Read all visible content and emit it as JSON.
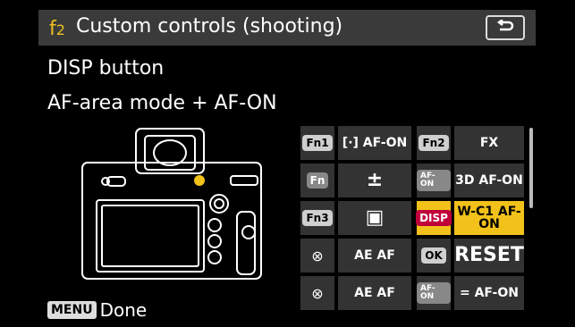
{
  "header": {
    "menu_letter": "f",
    "menu_number": "2",
    "title": "Custom controls (shooting)"
  },
  "info": {
    "button_name": "DISP button",
    "assignment": "AF-area mode + AF-ON"
  },
  "footer": {
    "menu_tag": "MENU",
    "done_label": "Done"
  },
  "grid": {
    "rows": [
      {
        "left_btn": "Fn1",
        "left_func": "[·] AF-ON",
        "right_btn": "Fn2",
        "right_func": "FX"
      },
      {
        "left_btn": "Fn",
        "left_func": "±",
        "right_btn": "AF-ON",
        "right_func": "3D AF-ON"
      },
      {
        "left_btn": "Fn3",
        "left_func": "▣",
        "right_btn": "DISP",
        "right_func": "W-C1 AF-ON",
        "selected": true
      },
      {
        "left_btn": "⊗",
        "left_func": "AE AF",
        "right_btn": "OK",
        "right_func": "RESET"
      },
      {
        "left_btn": "⊗",
        "left_func": "AE AF",
        "right_btn": "AF-ON",
        "right_func": "= AF-ON"
      }
    ]
  },
  "colors": {
    "accent": "#f2c21a",
    "header_bg": "#3a3a3a",
    "cell_bg": "#333333"
  }
}
